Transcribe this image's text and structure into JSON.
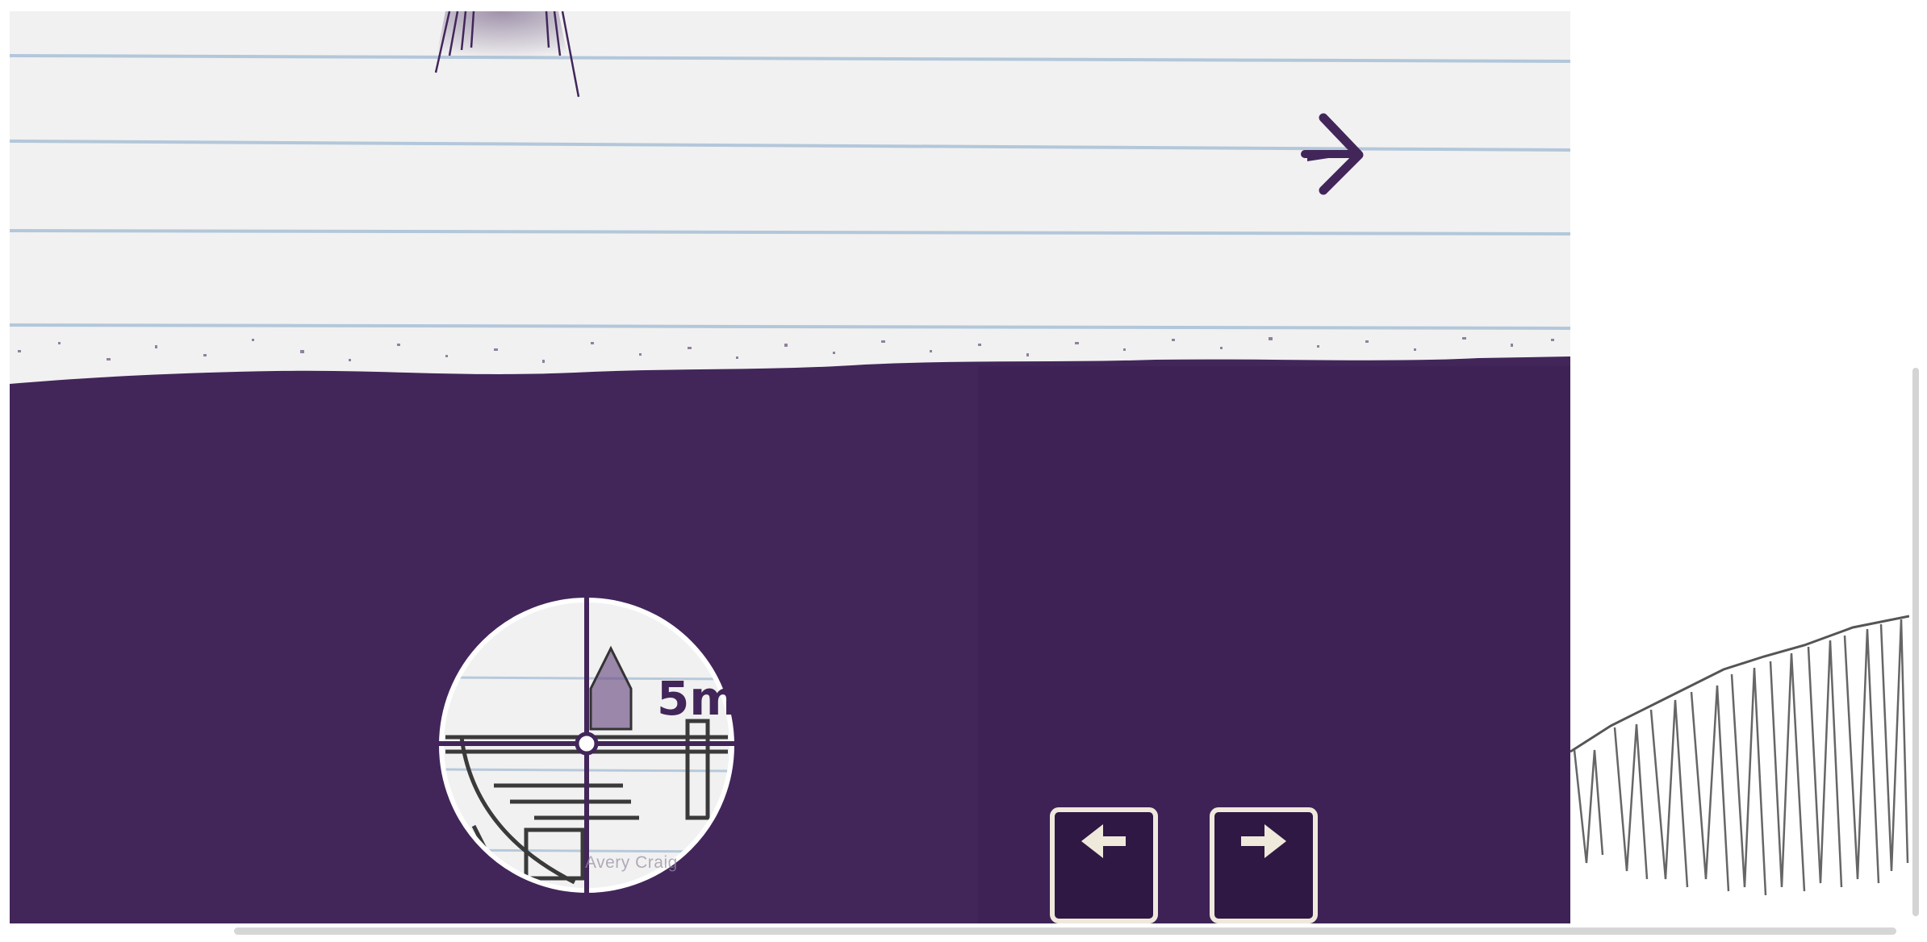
{
  "scene": {
    "paper_color": "#f1f1f1",
    "ruled_line_color": "#a9c0d6",
    "ink_color": "#42265a",
    "pencil_color": "#555555"
  },
  "scope": {
    "distance_label": "5m",
    "credit_text": "Avery Craig"
  },
  "controls": {
    "left_button_icon": "arrow-left-icon",
    "right_button_icon": "arrow-right-icon",
    "direction_icon": "arrow-right-icon"
  }
}
